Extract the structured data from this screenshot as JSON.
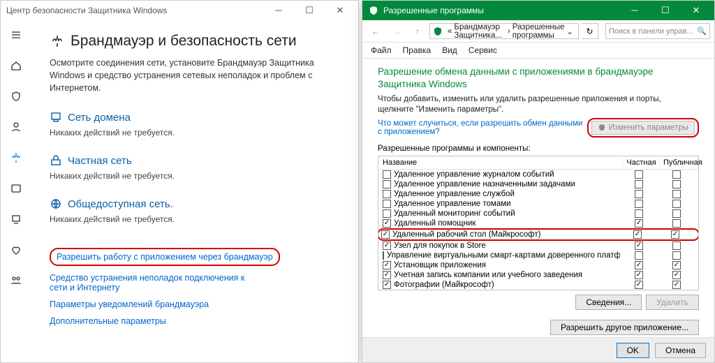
{
  "left": {
    "title": "Центр безопасности Защитника Windows",
    "h1": "Брандмауэр и безопасность сети",
    "desc": "Осмотрите соединения сети, установите Брандмауэр Защитника Windows и средство устранения сетевых неполадок и проблем с Интернетом.",
    "nets": {
      "domain": {
        "title": "Сеть домена",
        "sub": "Никаких действий не требуется."
      },
      "private": {
        "title": "Частная сеть",
        "sub": "Никаких действий не требуется."
      },
      "public": {
        "title": "Общедоступная сеть.",
        "sub": "Никаких действий не требуется."
      }
    },
    "links": {
      "allow": "Разрешить работу с приложением через брандмауэр",
      "troubleshoot": "Средство устранения неполадок подключения к сети и Интернету",
      "notify": "Параметры уведомлений брандмауэра",
      "advanced": "Дополнительные параметры"
    }
  },
  "right": {
    "title": "Разрешенные программы",
    "breadcrumb": {
      "b1": "Брандмауэр Защитника...",
      "b2": "Разрешенные программы"
    },
    "search_ph": "Поиск в панели управ...",
    "menu": {
      "file": "Файл",
      "edit": "Правка",
      "view": "Вид",
      "service": "Сервис"
    },
    "h1": "Разрешение обмена данными с приложениями в брандмауэре Защитника Windows",
    "desc": "Чтобы добавить, изменить или удалить разрешенные приложения и порты, щелкните \"Изменить параметры\".",
    "rlink": "Что может случиться, если разрешить обмен данными с приложением?",
    "change_btn": "Изменить параметры",
    "list_label": "Разрешенные программы и компоненты:",
    "cols": {
      "name": "Название",
      "private": "Частная",
      "public": "Публичная"
    },
    "rows": [
      {
        "name": "Удаленное управление журналом событий",
        "en": false,
        "priv": false,
        "pub": false
      },
      {
        "name": "Удаленное управление назначенными задачами",
        "en": false,
        "priv": false,
        "pub": false
      },
      {
        "name": "Удаленное управление службой",
        "en": false,
        "priv": false,
        "pub": false
      },
      {
        "name": "Удаленное управление томами",
        "en": false,
        "priv": false,
        "pub": false
      },
      {
        "name": "Удаленный мониторинг событий",
        "en": false,
        "priv": false,
        "pub": false
      },
      {
        "name": "Удаленный помощник",
        "en": true,
        "priv": true,
        "pub": false
      },
      {
        "name": "Удаленный рабочий стол (Майкрософт)",
        "en": true,
        "priv": true,
        "pub": true,
        "hl": true
      },
      {
        "name": "Узел для покупок в Store",
        "en": true,
        "priv": true,
        "pub": false
      },
      {
        "name": "Управление виртуальными смарт-картами доверенного платф...",
        "en": false,
        "priv": false,
        "pub": false
      },
      {
        "name": "Установщик приложения",
        "en": true,
        "priv": true,
        "pub": true
      },
      {
        "name": "Учетная запись компании или учебного заведения",
        "en": true,
        "priv": true,
        "pub": true
      },
      {
        "name": "Фотографии (Майкрософт)",
        "en": true,
        "priv": true,
        "pub": true
      }
    ],
    "btns": {
      "details": "Сведения...",
      "remove": "Удалить",
      "another": "Разрешить другое приложение...",
      "ok": "OK",
      "cancel": "Отмена"
    }
  }
}
